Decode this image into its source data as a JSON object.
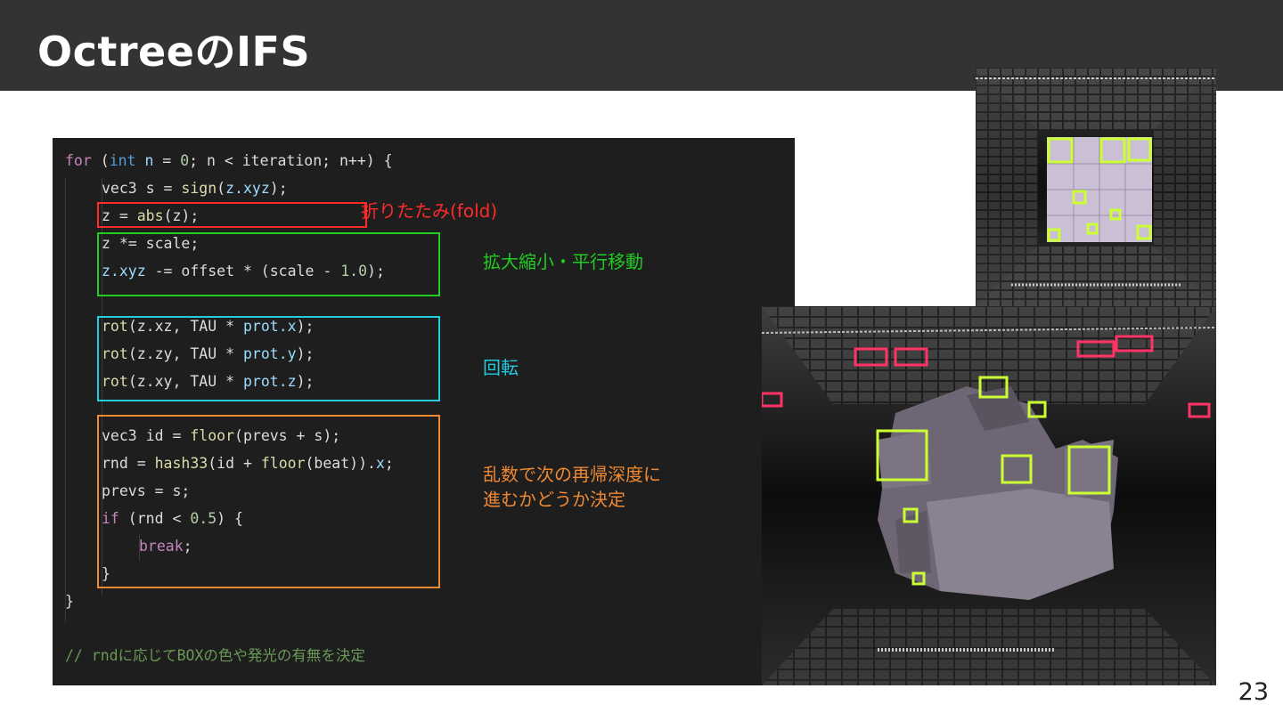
{
  "slide": {
    "title": "OctreeのIFS",
    "page_number": "23"
  },
  "code": {
    "l1": {
      "a": "for",
      "b": " (",
      "c": "int",
      "d": " ",
      "e": "n",
      "f": " = ",
      "g": "0",
      "h": "; n < iteration; n++) {"
    },
    "l2": {
      "a": "vec3 s = ",
      "b": "sign",
      "c": "(",
      "d": "z.xyz",
      "e": ");"
    },
    "l3": {
      "a": "z = ",
      "b": "abs",
      "c": "(z);"
    },
    "l4": {
      "a": "z *= scale;"
    },
    "l5": {
      "a": "z.xyz",
      "b": " -= offset * (scale - ",
      "c": "1.0",
      "d": ");"
    },
    "l6": {
      "a": "rot",
      "b": "(z.xz, TAU * ",
      "c": "prot.x",
      "d": ");"
    },
    "l7": {
      "a": "rot",
      "b": "(z.zy, TAU * ",
      "c": "prot.y",
      "d": ");"
    },
    "l8": {
      "a": "rot",
      "b": "(z.xy, TAU * ",
      "c": "prot.z",
      "d": ");"
    },
    "l9": {
      "a": "vec3 id = ",
      "b": "floor",
      "c": "(prevs + s);"
    },
    "l10": {
      "a": "rnd = ",
      "b": "hash33",
      "c": "(id + ",
      "d": "floor",
      "e": "(beat)).",
      "f": "x",
      "g": ";"
    },
    "l11": {
      "a": "prevs = s;"
    },
    "l12": {
      "a": "if",
      "b": " (rnd < ",
      "c": "0.5",
      "d": ") {"
    },
    "l13": {
      "a": "break",
      "b": ";"
    },
    "l14": {
      "a": "}"
    },
    "l15": {
      "a": "}"
    },
    "comment": "// rndに応じてBOXの色や発光の有無を決定"
  },
  "annotations": {
    "fold": "折りたたみ(fold)",
    "scale_translate": "拡大縮小・平行移動",
    "rotate": "回転",
    "random_line1": "乱数で次の再帰深度に",
    "random_line2": "進むかどうか決定"
  },
  "colors": {
    "fold": "#ff2a2a",
    "scale_translate": "#22cc22",
    "rotate": "#22ccdd",
    "random": "#ee8833"
  },
  "images": {
    "top_render": "octree-cube-render",
    "main_render": "octree-fractal-render"
  }
}
